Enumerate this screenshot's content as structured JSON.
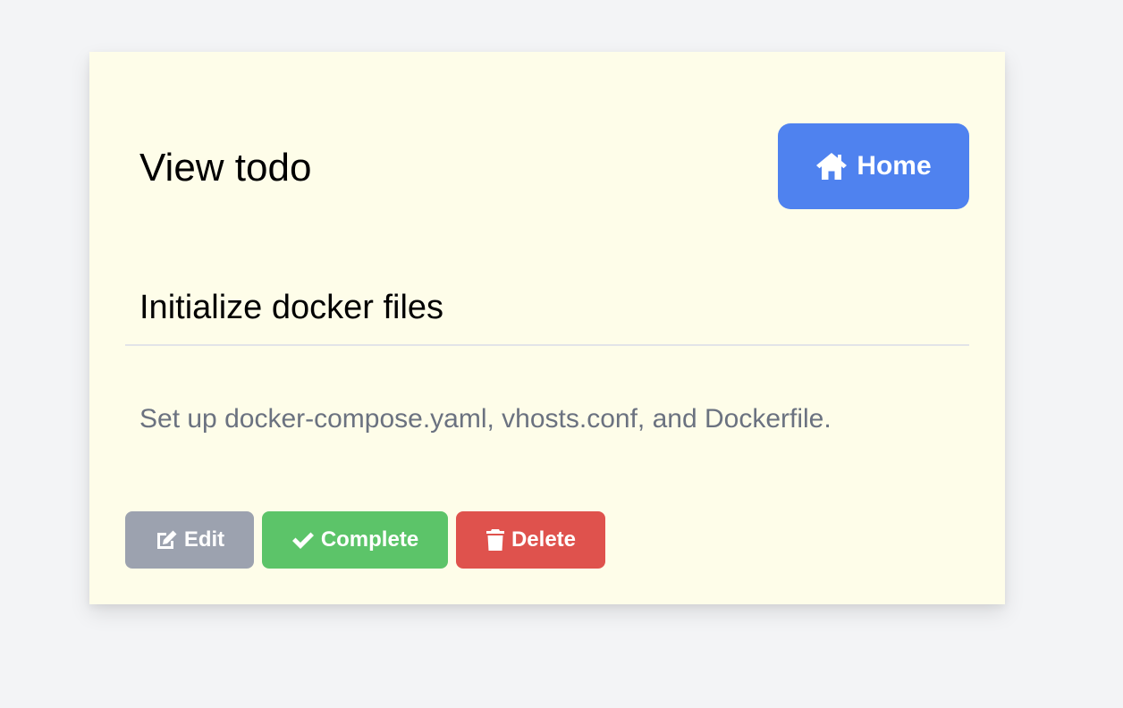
{
  "header": {
    "title": "View todo",
    "home_button": {
      "label": "Home",
      "icon": "home-icon"
    }
  },
  "todo": {
    "title": "Initialize docker files",
    "description": "Set up docker-compose.yaml, vhosts.conf, and Dockerfile."
  },
  "actions": {
    "edit": {
      "label": "Edit",
      "icon": "edit-icon",
      "color": "#9ca2af"
    },
    "complete": {
      "label": "Complete",
      "icon": "check-icon",
      "color": "#5cc469"
    },
    "delete": {
      "label": "Delete",
      "icon": "trash-icon",
      "color": "#df524d"
    }
  },
  "colors": {
    "card_background": "#fefde9",
    "page_background": "#f3f4f6",
    "primary": "#4f82ef"
  }
}
